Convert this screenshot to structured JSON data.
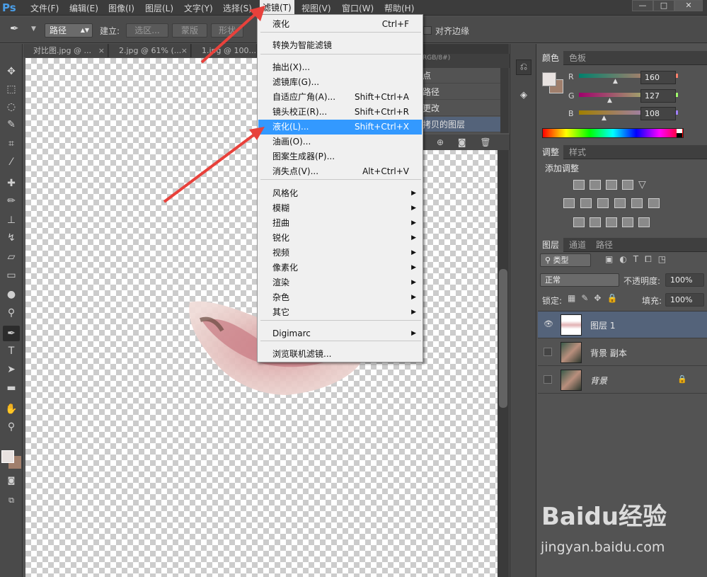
{
  "app": {
    "logo": "Ps"
  },
  "menubar": {
    "items": [
      "文件(F)",
      "编辑(E)",
      "图像(I)",
      "图层(L)",
      "文字(Y)",
      "选择(S)",
      "滤镜(T)",
      "视图(V)",
      "窗口(W)",
      "帮助(H)"
    ],
    "active": "滤镜(T)"
  },
  "window_controls": {
    "minimize": "—",
    "maximize": "□",
    "close": "✕"
  },
  "options_bar": {
    "mode_select": "路径",
    "create_label": "建立:",
    "selection_btn": "选区...",
    "mask_btn": "蒙版",
    "shape_btn": "形状",
    "align_edges": "对齐边缘"
  },
  "tabs": [
    "对比图.jpg @ ...",
    "2.jpg @ 61% (...",
    "1.jpg @ 100..."
  ],
  "tab_close": "×",
  "history_partial": [
    "点",
    "路径",
    "更改",
    "拷贝的图层"
  ],
  "history_header_partial": "RGB/8#)",
  "filter_menu": {
    "items": [
      {
        "label": "液化",
        "shortcut": "Ctrl+F"
      },
      {
        "label": "转换为智能滤镜",
        "shortcut": ""
      },
      {
        "label": "抽出(X)...",
        "shortcut": ""
      },
      {
        "label": "滤镜库(G)...",
        "shortcut": ""
      },
      {
        "label": "自适应广角(A)...",
        "shortcut": "Shift+Ctrl+A"
      },
      {
        "label": "镜头校正(R)...",
        "shortcut": "Shift+Ctrl+R"
      },
      {
        "label": "液化(L)...",
        "shortcut": "Shift+Ctrl+X",
        "highlighted": true
      },
      {
        "label": "油画(O)...",
        "shortcut": ""
      },
      {
        "label": "图案生成器(P)...",
        "shortcut": ""
      },
      {
        "label": "消失点(V)...",
        "shortcut": "Alt+Ctrl+V"
      },
      {
        "label": "风格化",
        "submenu": true
      },
      {
        "label": "模糊",
        "submenu": true
      },
      {
        "label": "扭曲",
        "submenu": true
      },
      {
        "label": "锐化",
        "submenu": true
      },
      {
        "label": "视频",
        "submenu": true
      },
      {
        "label": "像素化",
        "submenu": true
      },
      {
        "label": "渲染",
        "submenu": true
      },
      {
        "label": "杂色",
        "submenu": true
      },
      {
        "label": "其它",
        "submenu": true
      },
      {
        "label": "Digimarc",
        "submenu": true
      },
      {
        "label": "浏览联机滤镜...",
        "shortcut": ""
      }
    ]
  },
  "color_panel": {
    "tabs": [
      "颜色",
      "色板"
    ],
    "channels": [
      {
        "name": "R",
        "value": "160",
        "level": 0.63
      },
      {
        "name": "G",
        "value": "127",
        "level": 0.5
      },
      {
        "name": "B",
        "value": "108",
        "level": 0.42
      }
    ],
    "foreground": "#e8e2e0",
    "background": "#a07f6c"
  },
  "adjust_panel": {
    "tabs": [
      "调整",
      "样式"
    ],
    "title": "添加调整"
  },
  "layers_panel": {
    "tabs": [
      "图层",
      "通道",
      "路径"
    ],
    "filter_type": "类型",
    "blend_mode": "正常",
    "opacity_label": "不透明度:",
    "opacity": "100%",
    "lock_label": "锁定:",
    "fill_label": "填充:",
    "fill": "100%",
    "layers": [
      {
        "name": "图层 1",
        "selected": true,
        "visible": true
      },
      {
        "name": "背景 副本",
        "selected": false,
        "visible": false
      },
      {
        "name": "背景",
        "selected": false,
        "visible": false,
        "locked": true
      }
    ]
  },
  "watermark": {
    "brand": "Baidu经验",
    "url": "jingyan.baidu.com"
  },
  "colors": {
    "highlight": "#3399ff",
    "arrow": "#e8413b"
  }
}
